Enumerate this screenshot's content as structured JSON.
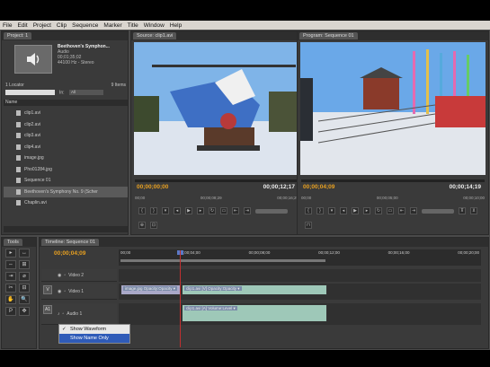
{
  "menu": [
    "File",
    "Edit",
    "Project",
    "Clip",
    "Sequence",
    "Marker",
    "Title",
    "Window",
    "Help"
  ],
  "project": {
    "tab": "Project: 1",
    "clip_title": "Beethoven's Symphon...",
    "clip_type": "Audio",
    "clip_duration": "00;01;35;02",
    "clip_rate": "44100 Hz - Stereo",
    "item_count_label": "1 Locator",
    "item_count": "9 Items",
    "in_label": "In:",
    "in_value": "All",
    "name_header": "Name",
    "items": [
      {
        "name": "clip1.avi",
        "selected": false
      },
      {
        "name": "clip2.avi",
        "selected": false
      },
      {
        "name": "clip3.avi",
        "selected": false
      },
      {
        "name": "clip4.avi",
        "selected": false
      },
      {
        "name": "image.jpg",
        "selected": false
      },
      {
        "name": "Pho01284.jpg",
        "selected": false
      },
      {
        "name": "Sequence 01",
        "selected": false
      },
      {
        "name": "Beethoven's Symphony No. 9 (Scher",
        "selected": true
      },
      {
        "name": "Chaplin.avi",
        "selected": false
      }
    ]
  },
  "source": {
    "tab": "Source: clip1.avi",
    "tc_left": "00;00;00;00",
    "tc_right": "00;00;12;17",
    "ticks": [
      "00;00",
      "00;00;08;29",
      "00;00;16;29"
    ]
  },
  "program": {
    "tab": "Program: Sequence 01",
    "tc_left": "00;00;04;09",
    "tc_right": "00;00;14;19",
    "ticks": [
      "00;00",
      "00;00;05;00",
      "00;00;10;00"
    ]
  },
  "tools_tab": "Tools",
  "tools": [
    "▸",
    "↔",
    "⇔",
    "⊞",
    "⇥",
    "⌀",
    "✂",
    "⊟",
    "✋",
    "🔍",
    "P",
    "✥"
  ],
  "timeline": {
    "tab": "Timeline: Sequence 01",
    "tc": "00;00;04;09",
    "ruler_labels": [
      "00;00",
      "00;00;04;00",
      "00;00;08;00",
      "00;00;12;00",
      "00;00;16;00",
      "00;00;20;00"
    ],
    "tracks": [
      {
        "target": "",
        "name": "Video 2"
      },
      {
        "target": "V",
        "name": "Video 1"
      },
      {
        "target": "A1",
        "name": "Audio 1"
      }
    ],
    "clips": {
      "image": "image.jpg  Opacity:Opacity ▾",
      "video": "clip1.avi [V]  Opacity:Opacity ▾",
      "audio": "clip1.avi [A]  Volume:Level ▾"
    }
  },
  "context_menu": {
    "items": [
      "Show Waveform",
      "Show Name Only"
    ],
    "checked_index": 0,
    "highlighted_index": 1
  },
  "colors": {
    "timecode": "#e8a020",
    "playhead": "#c03030",
    "menu_highlight": "#2f5bb8"
  }
}
